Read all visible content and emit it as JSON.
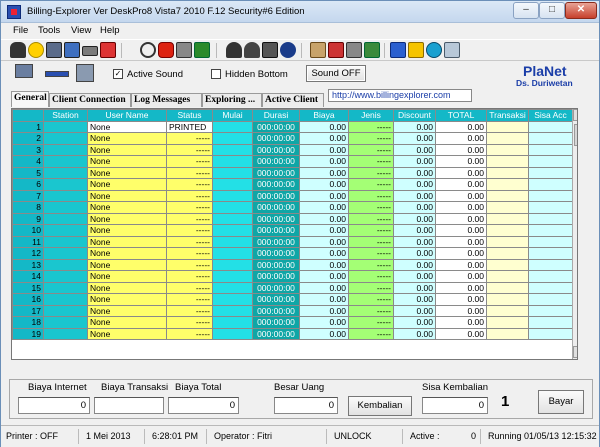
{
  "window": {
    "title": "Billing-Explorer Ver DeskPro8 Vista7 2010 F.12 Security#6 Edition"
  },
  "menu": [
    "File",
    "Tools",
    "View",
    "Help"
  ],
  "toolbar_icons": [
    "binoculars-icon",
    "smiley-icon",
    "monitor-icon",
    "monitor2-icon",
    "keyboard-icon",
    "chart-icon",
    "stop-icon",
    "stopsign-icon",
    "print-icon",
    "trash-icon",
    "users-icon",
    "user-icon",
    "network-icon",
    "phone-icon",
    "info-icon",
    "paint-icon",
    "brush-icon",
    "audio-icon",
    "gauge-icon",
    "stats-icon",
    "exit-icon",
    "lightning-icon",
    "drive-icon",
    "database-icon"
  ],
  "options": {
    "active_sound": "Active Sound",
    "active_sound_checked": true,
    "hidden_bottom": "Hidden Bottom",
    "hidden_bottom_checked": false,
    "sound_button": "Sound OFF"
  },
  "brand": {
    "name": "PlaNet",
    "sub": "Ds. Duriwetan"
  },
  "tabs": [
    "General",
    "Client Connection",
    "Log Messages",
    "Exploring ...",
    "Active Client"
  ],
  "url": "http://www.billingexplorer.com",
  "grid": {
    "columns": [
      "",
      "Station",
      "User Name",
      "Status",
      "Mulai",
      "Durasi",
      "Biaya",
      "Jenis",
      "Discount",
      "TOTAL",
      "Transaksi",
      "Sisa Acc"
    ],
    "rows": [
      {
        "no": "1",
        "user": "None",
        "status": "PRINTED",
        "durasi": "000:00:00",
        "biaya": "0.00",
        "jenis": "-----",
        "discount": "0.00",
        "total": "0.00"
      },
      {
        "no": "2",
        "user": "None",
        "status": "-----",
        "durasi": "000:00:00",
        "biaya": "0.00",
        "jenis": "-----",
        "discount": "0.00",
        "total": "0.00"
      },
      {
        "no": "3",
        "user": "None",
        "status": "-----",
        "durasi": "000:00:00",
        "biaya": "0.00",
        "jenis": "-----",
        "discount": "0.00",
        "total": "0.00"
      },
      {
        "no": "4",
        "user": "None",
        "status": "-----",
        "durasi": "000:00:00",
        "biaya": "0.00",
        "jenis": "-----",
        "discount": "0.00",
        "total": "0.00"
      },
      {
        "no": "5",
        "user": "None",
        "status": "-----",
        "durasi": "000:00:00",
        "biaya": "0.00",
        "jenis": "-----",
        "discount": "0.00",
        "total": "0.00"
      },
      {
        "no": "6",
        "user": "None",
        "status": "-----",
        "durasi": "000:00:00",
        "biaya": "0.00",
        "jenis": "-----",
        "discount": "0.00",
        "total": "0.00"
      },
      {
        "no": "7",
        "user": "None",
        "status": "-----",
        "durasi": "000:00:00",
        "biaya": "0.00",
        "jenis": "-----",
        "discount": "0.00",
        "total": "0.00"
      },
      {
        "no": "8",
        "user": "None",
        "status": "-----",
        "durasi": "000:00:00",
        "biaya": "0.00",
        "jenis": "-----",
        "discount": "0.00",
        "total": "0.00"
      },
      {
        "no": "9",
        "user": "None",
        "status": "-----",
        "durasi": "000:00:00",
        "biaya": "0.00",
        "jenis": "-----",
        "discount": "0.00",
        "total": "0.00"
      },
      {
        "no": "10",
        "user": "None",
        "status": "-----",
        "durasi": "000:00:00",
        "biaya": "0.00",
        "jenis": "-----",
        "discount": "0.00",
        "total": "0.00"
      },
      {
        "no": "11",
        "user": "None",
        "status": "-----",
        "durasi": "000:00:00",
        "biaya": "0.00",
        "jenis": "-----",
        "discount": "0.00",
        "total": "0.00"
      },
      {
        "no": "12",
        "user": "None",
        "status": "-----",
        "durasi": "000:00:00",
        "biaya": "0.00",
        "jenis": "-----",
        "discount": "0.00",
        "total": "0.00"
      },
      {
        "no": "13",
        "user": "None",
        "status": "-----",
        "durasi": "000:00:00",
        "biaya": "0.00",
        "jenis": "-----",
        "discount": "0.00",
        "total": "0.00"
      },
      {
        "no": "14",
        "user": "None",
        "status": "-----",
        "durasi": "000:00:00",
        "biaya": "0.00",
        "jenis": "-----",
        "discount": "0.00",
        "total": "0.00"
      },
      {
        "no": "15",
        "user": "None",
        "status": "-----",
        "durasi": "000:00:00",
        "biaya": "0.00",
        "jenis": "-----",
        "discount": "0.00",
        "total": "0.00"
      },
      {
        "no": "16",
        "user": "None",
        "status": "-----",
        "durasi": "000:00:00",
        "biaya": "0.00",
        "jenis": "-----",
        "discount": "0.00",
        "total": "0.00"
      },
      {
        "no": "17",
        "user": "None",
        "status": "-----",
        "durasi": "000:00:00",
        "biaya": "0.00",
        "jenis": "-----",
        "discount": "0.00",
        "total": "0.00"
      },
      {
        "no": "18",
        "user": "None",
        "status": "-----",
        "durasi": "000:00:00",
        "biaya": "0.00",
        "jenis": "-----",
        "discount": "0.00",
        "total": "0.00"
      },
      {
        "no": "19",
        "user": "None",
        "status": "-----",
        "durasi": "000:00:00",
        "biaya": "0.00",
        "jenis": "-----",
        "discount": "0.00",
        "total": "0.00"
      }
    ]
  },
  "bottom": {
    "biaya_internet_label": "Biaya Internet",
    "biaya_internet_value": "0",
    "biaya_transaksi_label": "Biaya Transaksi",
    "biaya_total_label": "Biaya Total",
    "biaya_total_value": "0",
    "besar_uang_label": "Besar Uang",
    "besar_uang_value": "0",
    "kembalian_button": "Kembalian",
    "sisa_kembalian_label": "Sisa Kembalian",
    "sisa_kembalian_value": "0",
    "big_number": "1",
    "bayar_button": "Bayar"
  },
  "statusbar": {
    "printer": "Printer : OFF",
    "date": "1 Mei 2013",
    "time": "6:28:01 PM",
    "operator": "Operator : Fitri",
    "unlock": "UNLOCK",
    "active": "Active :",
    "active_count": "0",
    "running": "Running 01/05/13  12:15:32"
  }
}
